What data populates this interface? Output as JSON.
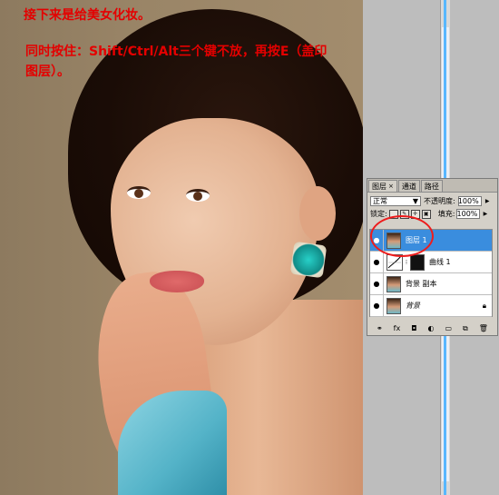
{
  "captions": {
    "line1": "接下来是给美女化妆。",
    "line2": "同时按住：Shift/Ctrl/Alt三个键不放，再按E（盖印图层）。"
  },
  "layers_panel": {
    "tabs": [
      {
        "label": "图层",
        "close": "×"
      },
      {
        "label": "通道"
      },
      {
        "label": "路径"
      }
    ],
    "blend_mode": "正常",
    "opacity_label": "不透明度:",
    "opacity_value": "100%",
    "lock_label": "锁定:",
    "fill_label": "填充:",
    "fill_value": "100%",
    "layers": [
      {
        "name": "图层 1",
        "selected": true
      },
      {
        "name": "曲线 1",
        "selected": false
      },
      {
        "name": "背景 副本",
        "selected": false
      },
      {
        "name": "背景",
        "selected": false
      }
    ],
    "bottom_icons": [
      "link-icon",
      "fx-icon",
      "mask-icon",
      "adjustment-icon",
      "folder-icon",
      "new-layer-icon",
      "trash-icon"
    ]
  },
  "colors": {
    "caption": "#e40000",
    "selection": "#3a8dde",
    "highlight_ring": "#ee1c1c"
  }
}
